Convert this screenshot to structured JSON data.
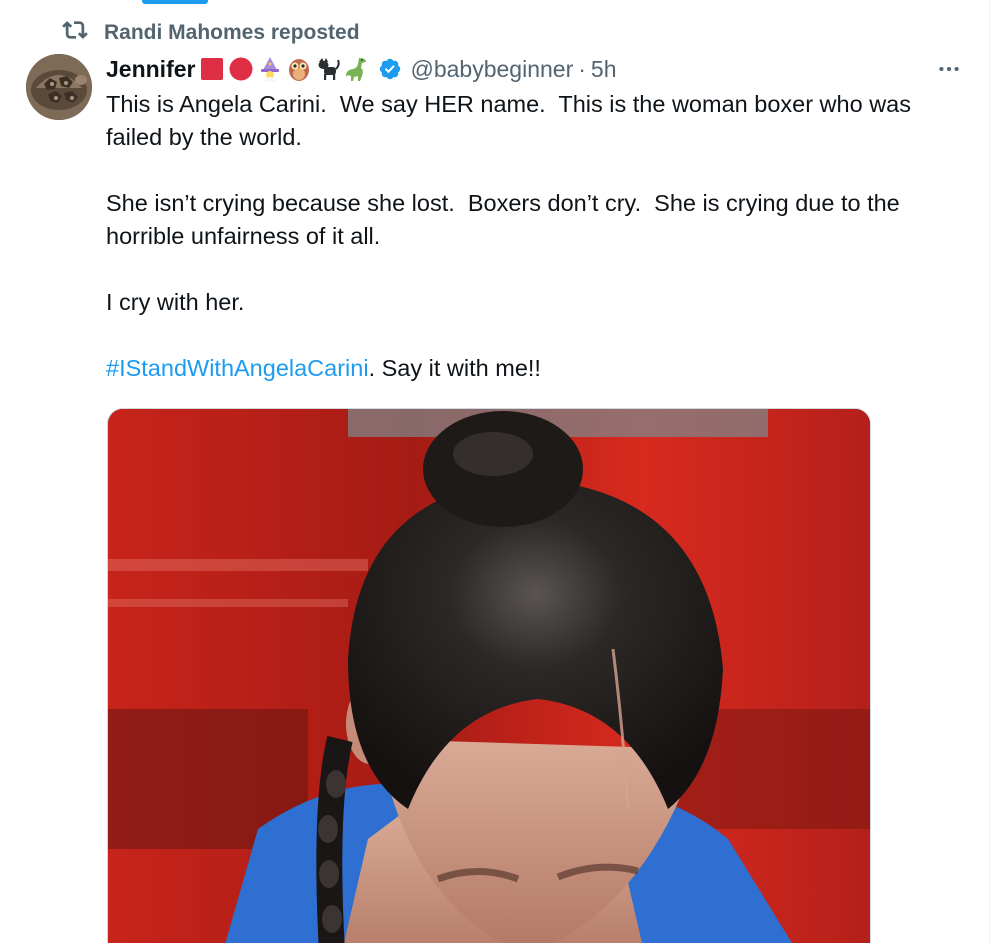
{
  "repost": {
    "label": "Randi Mahomes reposted"
  },
  "tweet": {
    "display_name": "Jennifer",
    "badges": [
      "red-square",
      "red-circle",
      "wizard",
      "owl",
      "black-cat",
      "dinosaur"
    ],
    "handle": "@babybeginner",
    "separator": "·",
    "time": "5h",
    "paragraphs": [
      "This is Angela Carini.  We say HER name.  This is the woman boxer who was failed by the world.",
      "She isn’t crying because she lost.  Boxers don’t cry.  She is crying due to the horrible unfairness of it all.",
      "I cry with her."
    ],
    "hashtag": "#IStandWithAngelaCarini",
    "hashtag_suffix": ". Say it with me!!"
  },
  "icons": {
    "repost": "repost-icon",
    "verified": "verified-badge-icon",
    "more": "more-options-icon"
  },
  "colors": {
    "link": "#1d9bf0",
    "secondary_text": "#536471",
    "primary_text": "#0f1419",
    "verified": "#1d9bf0"
  }
}
